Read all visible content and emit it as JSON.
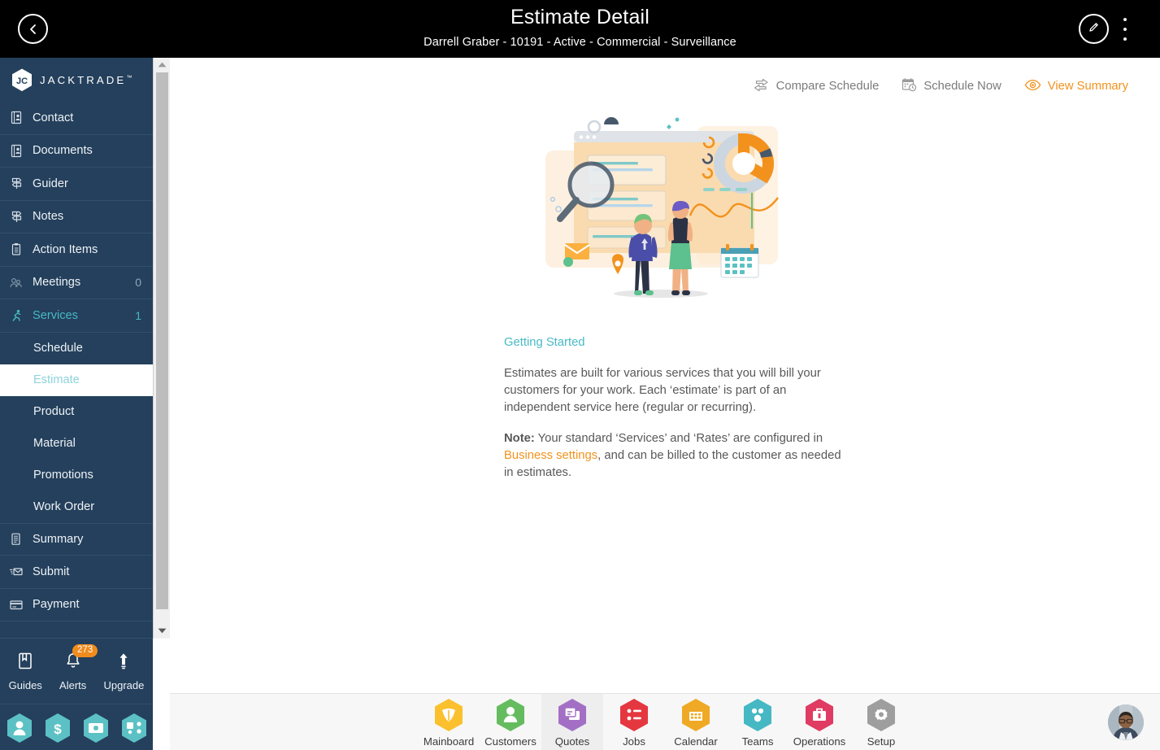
{
  "header": {
    "title": "Estimate Detail",
    "subtitle": "Darrell Graber - 10191 - Active - Commercial - Surveillance",
    "back_icon": "chevron-left-icon",
    "edit_icon": "pencil-icon",
    "menu_icon": "kebab-menu-icon",
    "background": "#000000"
  },
  "sidebar": {
    "brand": {
      "name": "JACKTRADE",
      "tm": "™"
    },
    "background": "#24405c",
    "accent": "#48b8c4",
    "items": [
      {
        "label": "Contact",
        "icon": "contact-card-icon",
        "count": "",
        "active": false
      },
      {
        "label": "Documents",
        "icon": "document-icon",
        "count": "",
        "active": false
      },
      {
        "label": "Guider",
        "icon": "signpost-icon",
        "count": "",
        "active": false
      },
      {
        "label": "Notes",
        "icon": "signpost-icon",
        "count": "",
        "active": false
      },
      {
        "label": "Action Items",
        "icon": "clipboard-icon",
        "count": "",
        "active": false
      },
      {
        "label": "Meetings",
        "icon": "meetings-icon",
        "count": "0",
        "active": false
      },
      {
        "label": "Services",
        "icon": "services-icon",
        "count": "1",
        "active": true
      }
    ],
    "sub_items": [
      {
        "label": "Schedule",
        "active": false
      },
      {
        "label": "Estimate",
        "active": true
      },
      {
        "label": "Product",
        "active": false
      },
      {
        "label": "Material",
        "active": false
      },
      {
        "label": "Promotions",
        "active": false
      },
      {
        "label": "Work Order",
        "active": false
      }
    ],
    "items_after": [
      {
        "label": "Summary",
        "icon": "summary-icon",
        "count": ""
      },
      {
        "label": "Submit",
        "icon": "submit-icon",
        "count": ""
      },
      {
        "label": "Payment",
        "icon": "payment-card-icon",
        "count": ""
      }
    ],
    "tools": [
      {
        "label": "Guides",
        "icon": "book-icon",
        "badge": ""
      },
      {
        "label": "Alerts",
        "icon": "bell-icon",
        "badge": "273"
      },
      {
        "label": "Upgrade",
        "icon": "upload-arrow-icon",
        "badge": ""
      }
    ],
    "quick_hexes": [
      {
        "icon": "person-hex-icon"
      },
      {
        "icon": "dollar-hex-icon"
      },
      {
        "icon": "money-hex-icon"
      },
      {
        "icon": "network-hex-icon"
      }
    ],
    "badge_color": "#f08b1d"
  },
  "main": {
    "actions": [
      {
        "label": "Compare Schedule",
        "icon": "compare-arrows-icon",
        "highlight": false
      },
      {
        "label": "Schedule Now",
        "icon": "calendar-clock-icon",
        "highlight": false
      },
      {
        "label": "View Summary",
        "icon": "eye-icon",
        "highlight": true
      }
    ],
    "illustration": "analytics-people-illustration",
    "getting_started_heading": "Getting Started",
    "paragraph_1": "Estimates are built for various services that you will bill your customers for your work. Each ‘estimate’ is part of an independent service here (regular or recurring).",
    "note_label": "Note:",
    "note_text_before_link": " Your standard ‘Services’ and ‘Rates’ are configured in ",
    "note_link": "Business settings",
    "note_text_after_link": ", and can be billed to the customer as needed in estimates.",
    "heading_color": "#49bac6",
    "link_color": "#f2921d"
  },
  "bottom_nav": {
    "items": [
      {
        "label": "Mainboard",
        "icon": "mainboard-hex-icon",
        "color": "#fbc02d",
        "selected": false
      },
      {
        "label": "Customers",
        "icon": "customers-hex-icon",
        "color": "#65bc5f",
        "selected": false
      },
      {
        "label": "Quotes",
        "icon": "quotes-hex-icon",
        "color": "#a36fc4",
        "selected": true
      },
      {
        "label": "Jobs",
        "icon": "jobs-hex-icon",
        "color": "#e5373f",
        "selected": false
      },
      {
        "label": "Calendar",
        "icon": "calendar-hex-icon",
        "color": "#f0a925",
        "selected": false
      },
      {
        "label": "Teams",
        "icon": "teams-hex-icon",
        "color": "#45b8c4",
        "selected": false
      },
      {
        "label": "Operations",
        "icon": "operations-hex-icon",
        "color": "#e03b62",
        "selected": false
      },
      {
        "label": "Setup",
        "icon": "setup-hex-icon",
        "color": "#9e9e9e",
        "selected": false
      }
    ],
    "avatar": "user-avatar",
    "background": "#f7f7f7"
  },
  "scrollbar": {
    "up_icon": "scroll-up-arrow-icon",
    "down_icon": "scroll-down-arrow-icon"
  }
}
